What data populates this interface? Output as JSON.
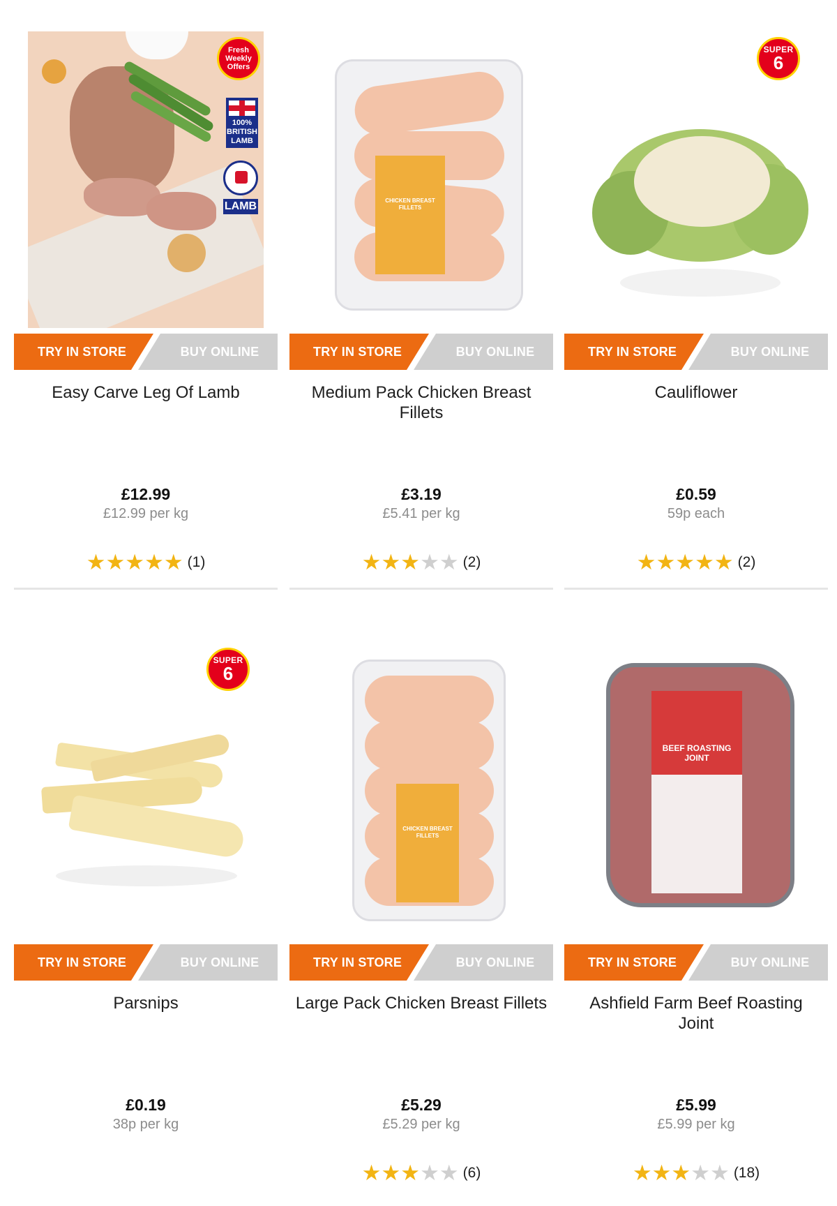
{
  "buttons": {
    "store": "TRY IN STORE",
    "online": "BUY ONLINE"
  },
  "badges": {
    "super_text": "SUPER",
    "super_num": "6",
    "fresh": "Fresh Weekly Offers",
    "british_lamb": "100% BRITISH LAMB",
    "lamb": "LAMB",
    "label_chicken": "CHICKEN BREAST FILLETS",
    "label_beef": "BEEF ROASTING JOINT"
  },
  "products": [
    {
      "name": "Easy Carve Leg Of Lamb",
      "price": "£12.99",
      "unit": "£12.99 per kg",
      "rating": 5,
      "reviews": "(1)",
      "image": "lamb-roast"
    },
    {
      "name": "Medium Pack Chicken Breast Fillets",
      "price": "£3.19",
      "unit": "£5.41 per kg",
      "rating": 3,
      "reviews": "(2)",
      "image": "chicken-medium"
    },
    {
      "name": "Cauliflower",
      "price": "£0.59",
      "unit": "59p each",
      "rating": 5,
      "reviews": "(2)",
      "image": "cauliflower"
    },
    {
      "name": "Parsnips",
      "price": "£0.19",
      "unit": "38p per kg",
      "rating": 0,
      "reviews": "",
      "image": "parsnips"
    },
    {
      "name": "Large Pack Chicken Breast Fillets",
      "price": "£5.29",
      "unit": "£5.29 per kg",
      "rating": 3,
      "reviews": "(6)",
      "image": "chicken-large"
    },
    {
      "name": "Ashfield Farm Beef Roasting Joint",
      "price": "£5.99",
      "unit": "£5.99 per kg",
      "rating": 3,
      "reviews": "(18)",
      "image": "beef-joint"
    }
  ],
  "colors": {
    "orange": "#ec6b12",
    "grey_button": "#cfcfcf",
    "star": "#f2b413"
  }
}
